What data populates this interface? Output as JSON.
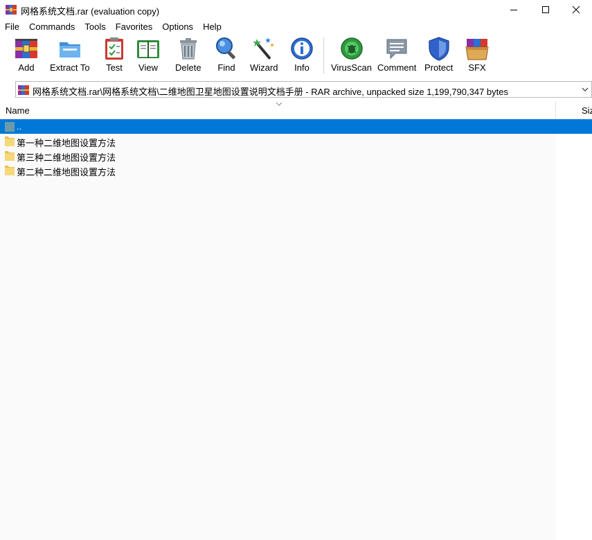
{
  "window": {
    "title": "网格系统文档.rar (evaluation copy)",
    "controls": {
      "minimize": "minimize",
      "maximize": "maximize",
      "close": "close"
    }
  },
  "menu": [
    "File",
    "Commands",
    "Tools",
    "Favorites",
    "Options",
    "Help"
  ],
  "toolbar": [
    {
      "label": "Add",
      "icon": "add-archive-icon"
    },
    {
      "label": "Extract To",
      "icon": "extract-folder-icon"
    },
    {
      "label": "Test",
      "icon": "test-clipboard-icon"
    },
    {
      "label": "View",
      "icon": "view-book-icon"
    },
    {
      "label": "Delete",
      "icon": "trash-icon"
    },
    {
      "label": "Find",
      "icon": "magnifier-icon"
    },
    {
      "label": "Wizard",
      "icon": "magic-wand-icon"
    },
    {
      "label": "Info",
      "icon": "info-icon"
    },
    {
      "label": "VirusScan",
      "icon": "virus-scan-icon"
    },
    {
      "label": "Comment",
      "icon": "comment-icon"
    },
    {
      "label": "Protect",
      "icon": "shield-icon"
    },
    {
      "label": "SFX",
      "icon": "sfx-box-icon"
    }
  ],
  "address": {
    "path": "网格系统文档.rar\\网格系统文档\\二维地图卫星地图设置说明文档手册 - RAR archive, unpacked size 1,199,790,347 bytes"
  },
  "list": {
    "columns": {
      "name": "Name",
      "size": "Siz"
    },
    "rows": [
      {
        "name": "..",
        "type": "parent",
        "selected": true
      },
      {
        "name": "第一种二维地图设置方法",
        "type": "folder",
        "selected": false
      },
      {
        "name": "第三种二维地图设置方法",
        "type": "folder",
        "selected": false
      },
      {
        "name": "第二种二维地图设置方法",
        "type": "folder",
        "selected": false
      }
    ]
  },
  "colors": {
    "selection": "#0078d7",
    "folder": "#f6d77a",
    "parent_folder": "#6b9aa8"
  }
}
